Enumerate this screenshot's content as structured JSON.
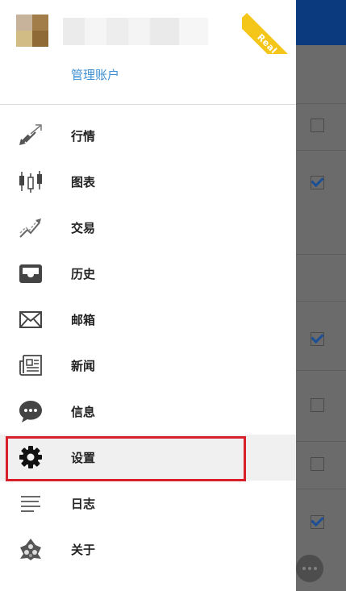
{
  "drawer": {
    "manage_accounts_label": "管理账户",
    "account_badge": "Real"
  },
  "menu": {
    "items": [
      {
        "label": "行情",
        "icon": "quotes-arrows-icon"
      },
      {
        "label": "图表",
        "icon": "candlestick-chart-icon"
      },
      {
        "label": "交易",
        "icon": "trade-trend-icon"
      },
      {
        "label": "历史",
        "icon": "history-inbox-icon"
      },
      {
        "label": "邮箱",
        "icon": "mail-envelope-icon"
      },
      {
        "label": "新闻",
        "icon": "news-icon"
      },
      {
        "label": "信息",
        "icon": "chat-bubble-icon"
      },
      {
        "label": "设置",
        "icon": "gear-icon"
      },
      {
        "label": "日志",
        "icon": "journal-lines-icon"
      },
      {
        "label": "关于",
        "icon": "about-logo-icon"
      }
    ],
    "selected_index": 7
  },
  "background_list": {
    "checkboxes": [
      false,
      true,
      true,
      false,
      false,
      true
    ]
  },
  "colors": {
    "header_blue": "#0b3b7e",
    "link_blue": "#3e8fd1",
    "badge_yellow": "#f5c61a",
    "highlight_red": "#d8202a"
  }
}
